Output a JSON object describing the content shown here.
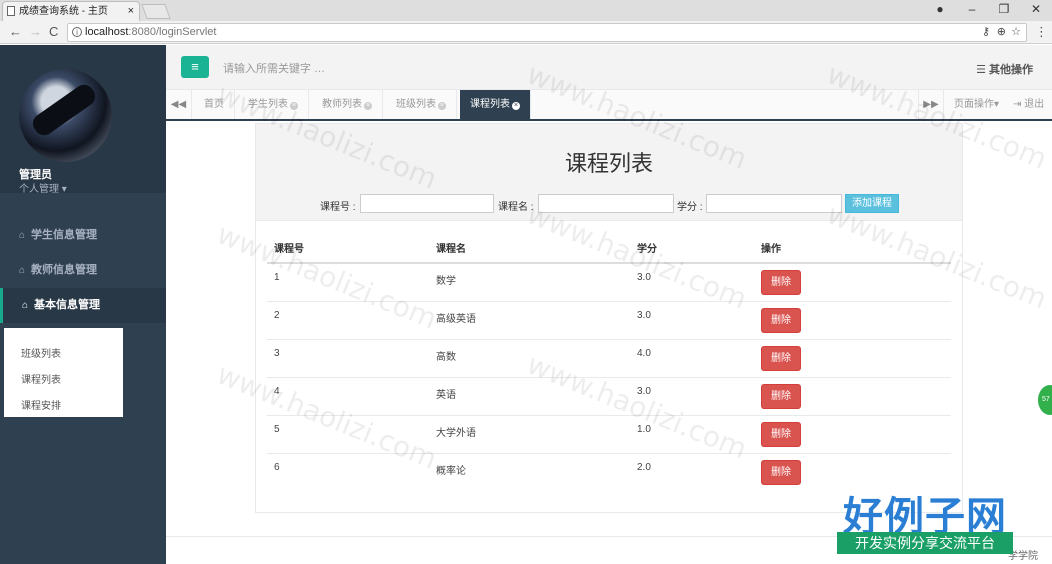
{
  "browser": {
    "tab_title": "成绩查询系统 - 主页",
    "tab_close": "×",
    "url_host": "localhost",
    "url_rest": ":8080/loginServlet",
    "win_minimize": "–",
    "win_restore": "❐",
    "win_close": "✕",
    "back": "←",
    "forward": "→",
    "reload": "C"
  },
  "sidebar": {
    "user_name": "管理员",
    "user_menu": "个人管理 ▾",
    "items": [
      {
        "label": "学生信息管理"
      },
      {
        "label": "教师信息管理"
      },
      {
        "label": "基本信息管理"
      }
    ],
    "submenu": [
      {
        "label": "班级列表"
      },
      {
        "label": "课程列表"
      },
      {
        "label": "课程安排"
      }
    ]
  },
  "header": {
    "search_placeholder": "请输入所需关键字 …",
    "other_ops": "其他操作"
  },
  "page_tabs": {
    "home": "首页",
    "tabs": [
      {
        "label": "学生列表"
      },
      {
        "label": "教师列表"
      },
      {
        "label": "班级列表"
      },
      {
        "label": "课程列表"
      }
    ],
    "page_ops": "页面操作▾",
    "logout": "退出"
  },
  "main": {
    "title": "课程列表",
    "filter": {
      "course_no_label": "课程号 :",
      "course_name_label": "课程名 :",
      "credit_label": "学分 :",
      "add_button": "添加课程"
    },
    "table": {
      "columns": [
        "课程号",
        "课程名",
        "学分",
        "操作"
      ],
      "delete_label": "删除",
      "rows": [
        {
          "no": "1",
          "name": "数学",
          "credit": "3.0"
        },
        {
          "no": "2",
          "name": "高级英语",
          "credit": "3.0"
        },
        {
          "no": "3",
          "name": "高数",
          "credit": "4.0"
        },
        {
          "no": "4",
          "name": "英语",
          "credit": "3.0"
        },
        {
          "no": "5",
          "name": "大学外语",
          "credit": "1.0"
        },
        {
          "no": "6",
          "name": "概率论",
          "credit": "2.0"
        }
      ]
    },
    "footer": "学学院"
  },
  "watermark": {
    "site_text": "www.haolizi.com",
    "logo_title": "好例子网",
    "logo_sub": "开发实例分享交流平台"
  },
  "colors": {
    "sidebar_bg": "#2f4050",
    "accent": "#1ab394",
    "danger": "#d9534f",
    "info": "#5bc0de"
  }
}
